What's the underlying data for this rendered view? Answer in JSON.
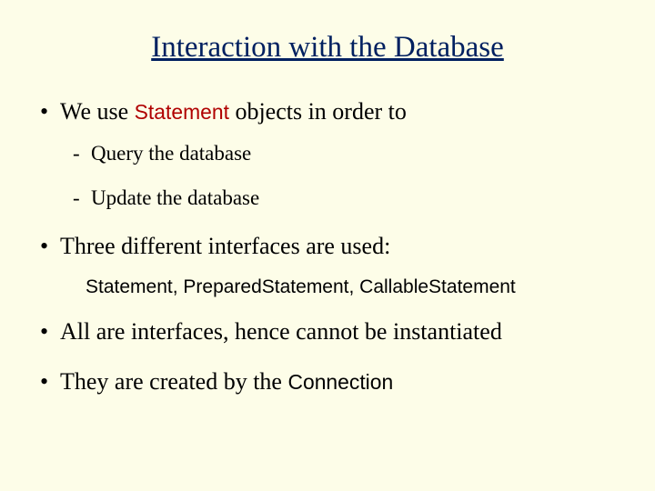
{
  "title": "Interaction with the Database",
  "bullet1": {
    "pre": "We use ",
    "code": "Statement",
    "post": " objects in order to",
    "sub1": "Query the database",
    "sub2": "Update the database"
  },
  "bullet2": {
    "text": "Three different interfaces are used:",
    "interfaces": "Statement, PreparedStatement, CallableStatement"
  },
  "bullet3": "All are interfaces, hence cannot be instantiated",
  "bullet4": {
    "pre": "They are created by the ",
    "code": "Connection"
  }
}
